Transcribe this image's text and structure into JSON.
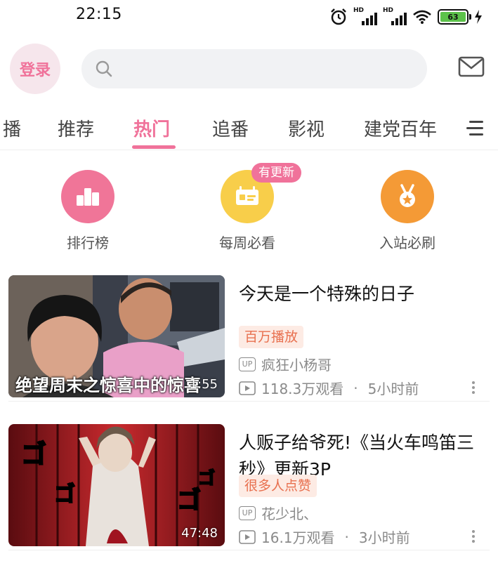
{
  "status_bar": {
    "time": "22:15",
    "signal1": "HD",
    "signal2": "HD",
    "battery": "63"
  },
  "header": {
    "login_label": "登录",
    "search_placeholder": "",
    "icons": [
      "search-icon",
      "mail-icon"
    ]
  },
  "tabs": [
    {
      "label": "播"
    },
    {
      "label": "推荐"
    },
    {
      "label": "热门",
      "active": true
    },
    {
      "label": "追番"
    },
    {
      "label": "影视"
    },
    {
      "label": "建党百年"
    }
  ],
  "quick_entries": [
    {
      "label": "排行榜",
      "icon": "ranking-icon",
      "color": "#f07598"
    },
    {
      "label": "每周必看",
      "icon": "weekly-icon",
      "color": "#f8ce4a",
      "badge": "有更新"
    },
    {
      "label": "入站必刷",
      "icon": "medal-icon",
      "color": "#f49a36"
    }
  ],
  "videos": [
    {
      "title": "今天是一个特殊的日子",
      "thumb_text": "绝望周末之惊喜中的惊喜",
      "duration": "1:55",
      "tag": "百万播放",
      "up_label": "UP",
      "author": "疯狂小杨哥",
      "views": "118.3万观看",
      "separator": "·",
      "time": "5小时前"
    },
    {
      "title": "人贩子给爷死!《当火车鸣笛三秒》更新3P",
      "duration": "47:48",
      "tag": "很多人点赞",
      "up_label": "UP",
      "author": "花少北、",
      "views": "16.1万观看",
      "separator": "·",
      "time": "3小时前"
    }
  ],
  "colors": {
    "accent": "#f0729a",
    "tag_bg": "#fdebe4",
    "tag_text": "#e8704f"
  }
}
